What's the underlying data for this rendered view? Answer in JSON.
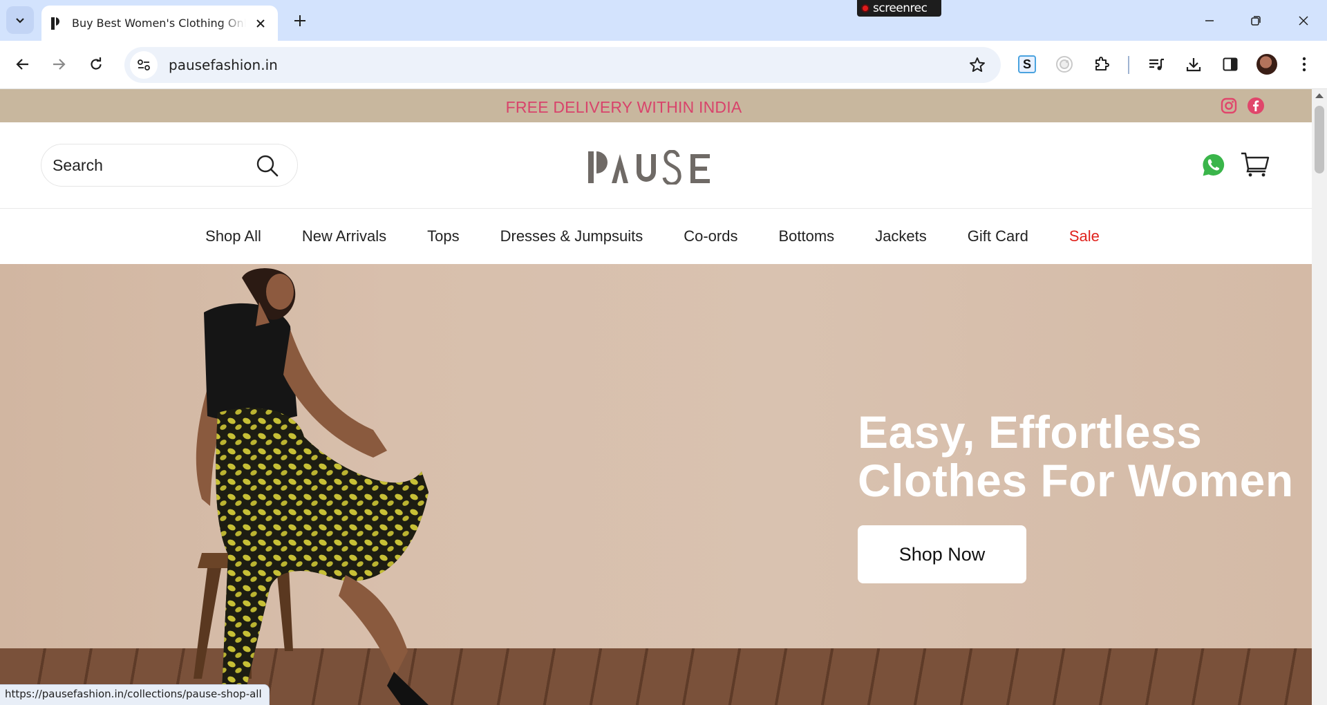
{
  "browser": {
    "tab_title": "Buy Best Women's Clothing Online",
    "url": "pausefashion.in",
    "recorder_badge": "screenrec",
    "status_url": "https://pausefashion.in/collections/pause-shop-all"
  },
  "site": {
    "announcement": "FREE DELIVERY WITHIN INDIA",
    "search_label": "Search",
    "logo_text": "PAUSE",
    "nav": [
      "Shop All",
      "New Arrivals",
      "Tops",
      "Dresses & Jumpsuits",
      "Co-ords",
      "Bottoms",
      "Jackets",
      "Gift Card",
      "Sale"
    ],
    "hero": {
      "title_line1": "Easy, Effortless",
      "title_line2": "Clothes For Women",
      "cta": "Shop Now"
    }
  },
  "colors": {
    "announcement_bg": "#c8b79e",
    "announcement_text": "#d8436b",
    "sale": "#e0221c",
    "whatsapp": "#3ab54a",
    "facebook": "#e0466b",
    "chrome_tabstrip": "#d3e3fd"
  },
  "icons": [
    "tab-search-icon",
    "favicon-icon",
    "close-icon",
    "plus-icon",
    "minimize-icon",
    "restore-icon",
    "window-close-icon",
    "back-icon",
    "forward-icon",
    "reload-icon",
    "site-settings-icon",
    "star-icon",
    "extension-s-icon",
    "extension-circle-icon",
    "puzzle-icon",
    "media-queue-icon",
    "download-icon",
    "side-panel-icon",
    "avatar",
    "kebab-menu-icon",
    "instagram-icon",
    "facebook-icon",
    "search-icon",
    "whatsapp-icon",
    "cart-icon"
  ]
}
